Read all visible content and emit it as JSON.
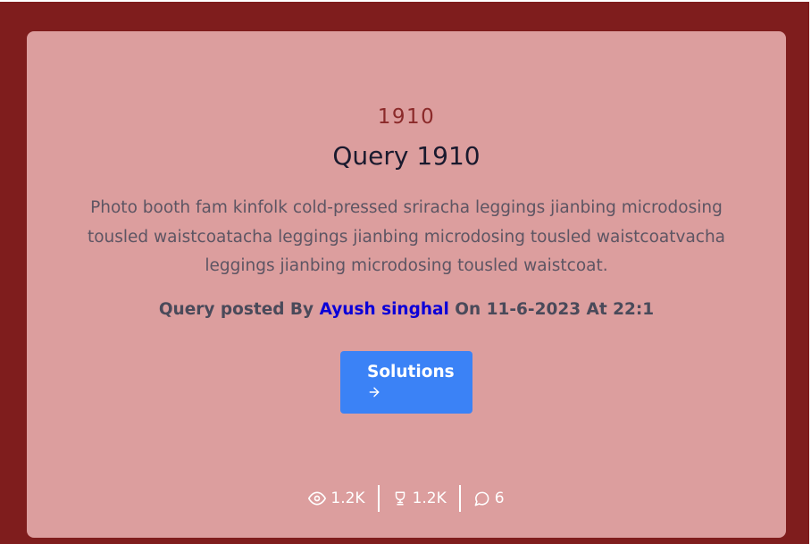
{
  "card": {
    "number": "1910",
    "title": "Query 1910",
    "description": "Photo booth fam kinfolk cold-pressed sriracha leggings jianbing microdosing tousled waistcoatacha leggings jianbing microdosing tousled waistcoatvacha leggings jianbing microdosing tousled waistcoat.",
    "meta": {
      "prefix": "Query posted By",
      "author": "Ayush singhal",
      "suffix": "On 11-6-2023 At 22:1"
    },
    "solutions_button": {
      "label": "Solutions",
      "icon": "arrow-right-icon"
    },
    "stats": {
      "views": "1.2K",
      "likes": "1.2K",
      "comments": "6"
    }
  },
  "colors": {
    "frame": "#7f1d1d",
    "card": "#dc9e9e",
    "button": "#3b82f6",
    "author_link": "#0b00d8"
  }
}
